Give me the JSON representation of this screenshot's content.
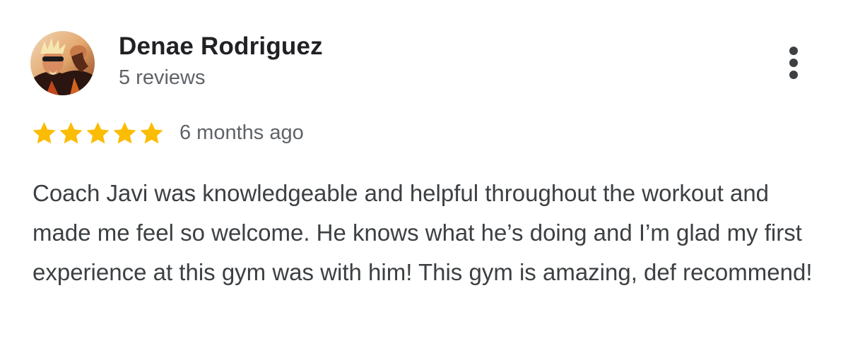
{
  "review": {
    "author": {
      "name": "Denae Rodriguez",
      "review_count": "5 reviews",
      "avatar": "profile-photo"
    },
    "rating": {
      "stars": 5,
      "max_stars": 5,
      "star_color": "#fbbc04"
    },
    "date": "6 months ago",
    "text": "Coach Javi was knowledgeable and helpful throughout the workout and made me feel so welcome. He knows what he’s doing and I’m glad my first experience at this gym was with him! This gym is amazing, def recommend!",
    "menu_icon": "more-vert-icon"
  }
}
